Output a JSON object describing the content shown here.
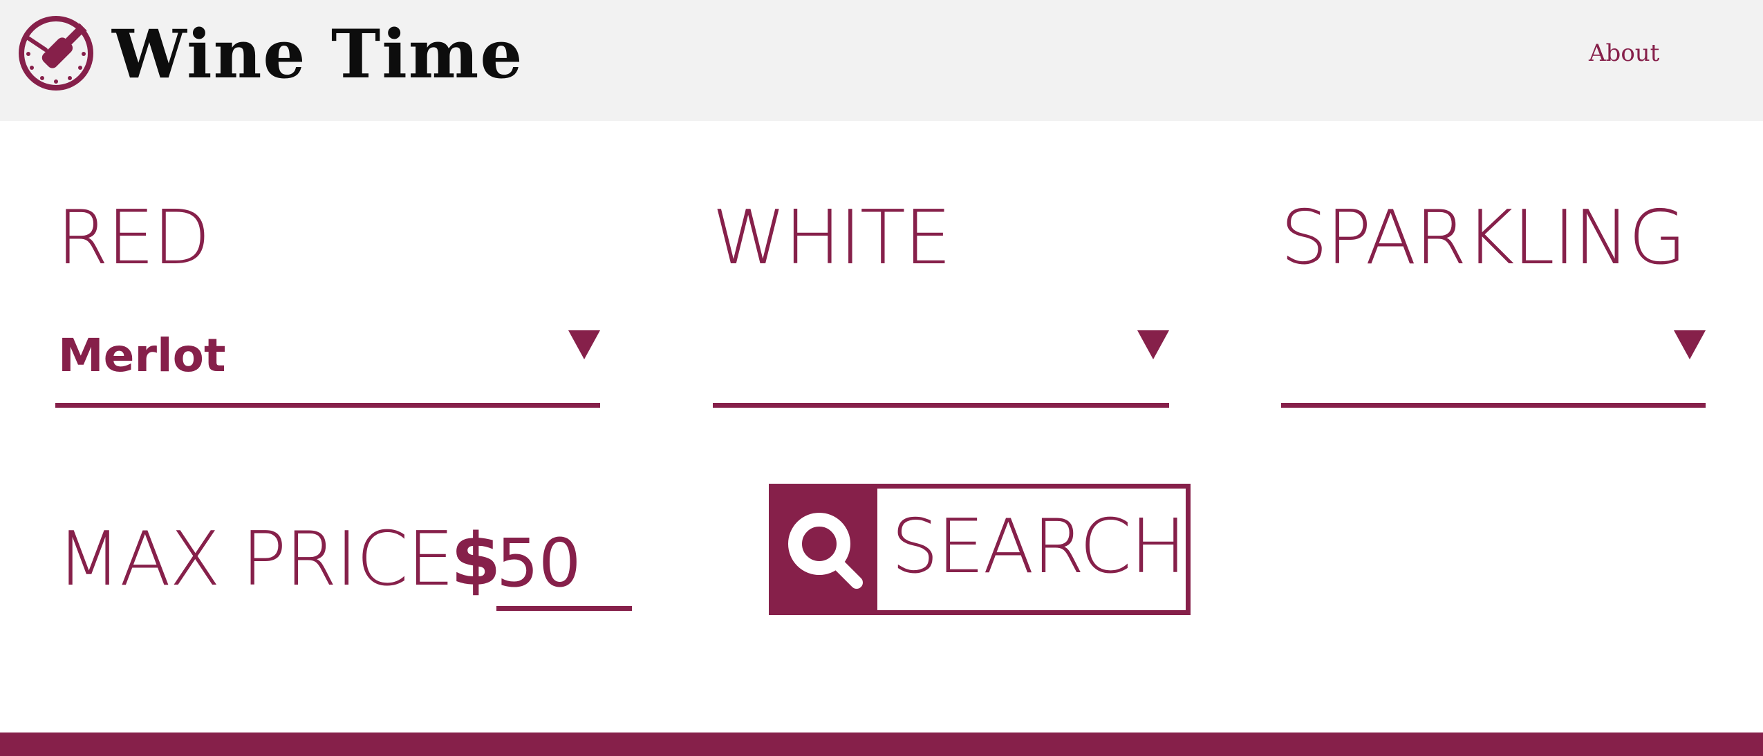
{
  "header": {
    "brand": "Wine Time",
    "logo_icon": "clock-wine-bottle-icon",
    "nav_about": "About"
  },
  "filters": {
    "red": {
      "label": "RED",
      "selected": "Merlot"
    },
    "white": {
      "label": "WHITE",
      "selected": ""
    },
    "sparkling": {
      "label": "SPARKLING",
      "selected": ""
    }
  },
  "price": {
    "label": "MAX PRICE",
    "currency": "$",
    "value": "50"
  },
  "search": {
    "label": "SEARCH",
    "icon": "search-icon"
  },
  "colors": {
    "accent": "#86204a",
    "header_bg": "#f2f2f2",
    "text_dark": "#0d0d0d"
  }
}
